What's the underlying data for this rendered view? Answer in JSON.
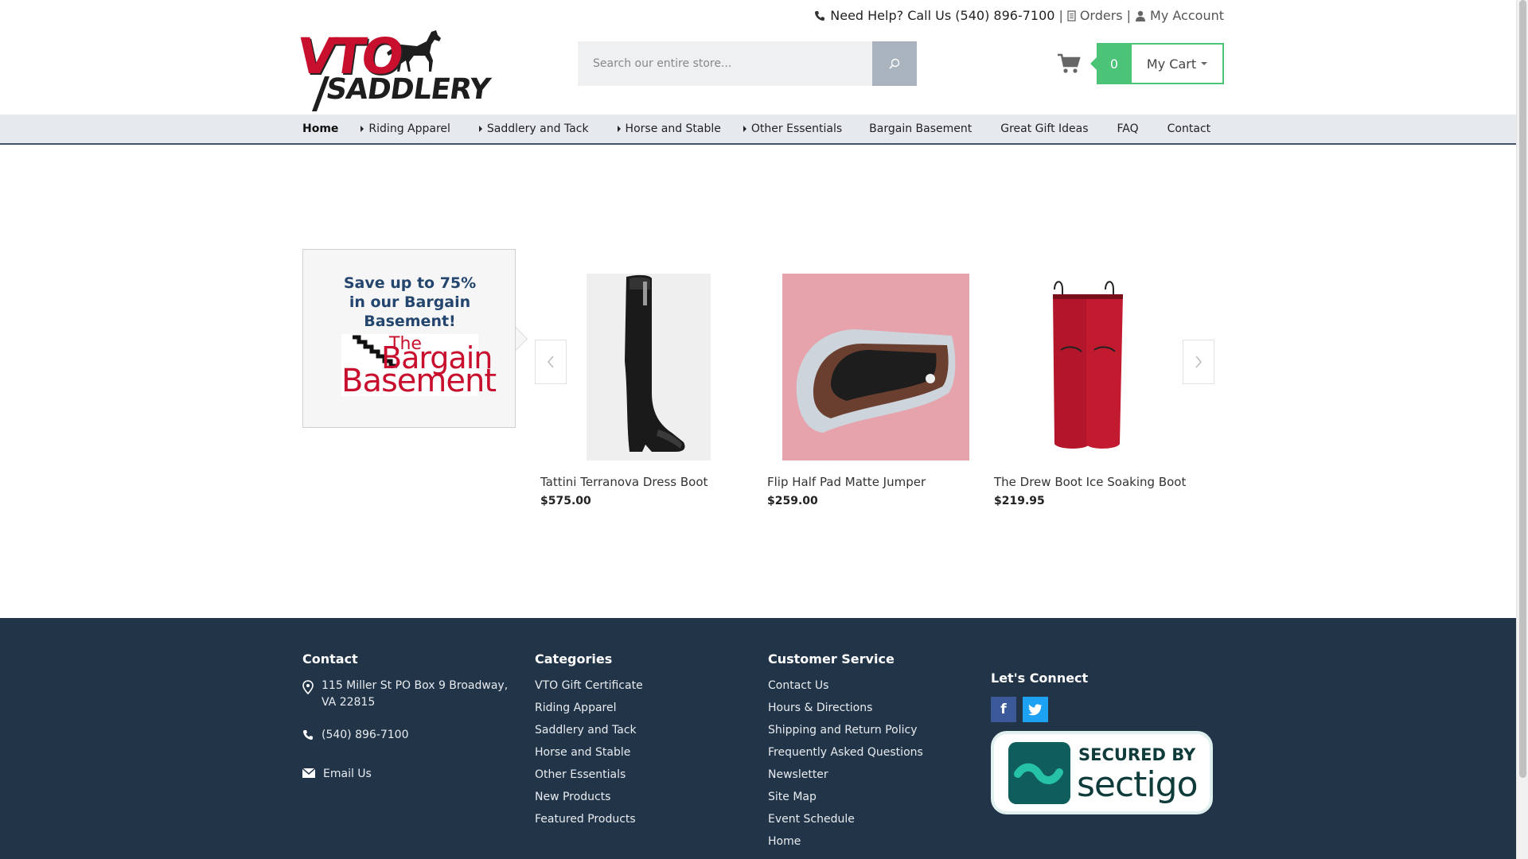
{
  "brand": {
    "logo_line1": "VTO",
    "logo_line2": "SADDLERY"
  },
  "toplinks": {
    "help": "Need Help? Call Us (540) 896-7100",
    "sep1": "|",
    "orders": "Orders",
    "sep2": "|",
    "account": "My Account"
  },
  "search": {
    "placeholder": "Search our entire store..."
  },
  "cart": {
    "count": "0",
    "label": "My Cart"
  },
  "nav": {
    "items": [
      {
        "label": "Home",
        "has_children": false
      },
      {
        "label": "Riding Apparel",
        "has_children": true
      },
      {
        "label": "Saddlery and Tack",
        "has_children": true
      },
      {
        "label": "Horse and Stable",
        "has_children": true
      },
      {
        "label": "Other Essentials",
        "has_children": true
      },
      {
        "label": "Bargain Basement",
        "has_children": false
      },
      {
        "label": "Great Gift Ideas",
        "has_children": false
      },
      {
        "label": "FAQ",
        "has_children": false
      },
      {
        "label": "Contact",
        "has_children": false
      }
    ]
  },
  "promo": {
    "line1": "Save up to 75%",
    "line2": "in our Bargain",
    "line3": "Basement!",
    "logo_the": "The",
    "logo_bargain": "Bargain",
    "logo_basement": "Basement"
  },
  "products": [
    {
      "name": "Tattini Terranova Dress Boot",
      "price": "$575.00"
    },
    {
      "name": "Flip Half Pad Matte Jumper",
      "price": "$259.00"
    },
    {
      "name": "The Drew Boot Ice Soaking Boot",
      "price": "$219.95"
    }
  ],
  "footer": {
    "contact": {
      "title": "Contact",
      "address_line1": "115 Miller St PO Box 9 Broadway,",
      "address_line2": "VA 22815",
      "phone": "(540) 896-7100",
      "email": "Email Us"
    },
    "categories": {
      "title": "Categories",
      "items": [
        "VTO Gift Certificate",
        "Riding Apparel",
        "Saddlery and Tack",
        "Horse and Stable",
        "Other Essentials",
        "New Products",
        "Featured Products"
      ]
    },
    "customer_service": {
      "title": "Customer Service",
      "items": [
        "Contact Us",
        "Hours & Directions",
        "Shipping and Return Policy",
        "Frequently Asked Questions",
        "Newsletter",
        "Site Map",
        "Event Schedule",
        "Home"
      ]
    },
    "connect": {
      "title": "Let's Connect",
      "facebook": "f"
    },
    "badge": {
      "line1": "SECURED BY",
      "line2": "sectigo"
    }
  },
  "colors": {
    "brand_red": "#c8102e",
    "cart_green": "#4cc477",
    "footer_bg": "#223448",
    "nav_bg": "#e6e9ee",
    "promo_blue": "#24466e"
  }
}
